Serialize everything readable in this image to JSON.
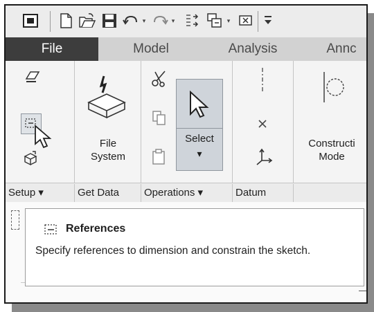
{
  "qat": {
    "icons": [
      "window-icon",
      "new-file-icon",
      "open-file-icon",
      "save-icon",
      "undo-icon",
      "redo-icon",
      "regenerate-icon",
      "windows-icon",
      "close-window-icon",
      "customize-icon"
    ],
    "dropdown_glyph": "▾"
  },
  "tabs": [
    {
      "label": "File"
    },
    {
      "label": "Model"
    },
    {
      "label": "Analysis"
    },
    {
      "label": "Annc"
    }
  ],
  "ribbon": {
    "file_system": {
      "line1": "File",
      "line2": "System"
    },
    "select": {
      "label": "Select",
      "arrow": "▾"
    },
    "construction": {
      "line1": "Constructi",
      "line2": "Mode"
    }
  },
  "groups": [
    {
      "label": "Setup ▾"
    },
    {
      "label": "Get Data"
    },
    {
      "label": "Operations ▾"
    },
    {
      "label": "Datum"
    }
  ],
  "tooltip": {
    "title": "References",
    "description": "Specify references to dimension and constrain the sketch."
  },
  "colors": {
    "file_tab": "#3d3d3d",
    "tab_bar": "#d2d2d2",
    "select_button": "#cfd4da"
  }
}
